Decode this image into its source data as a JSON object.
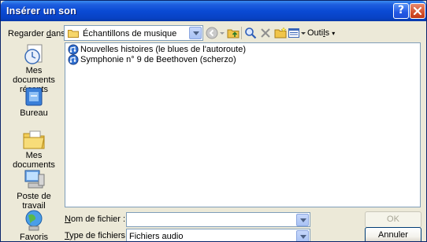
{
  "window": {
    "title": "Insérer un son",
    "help_button": "?"
  },
  "lookin": {
    "label_pre": "Regarder ",
    "label_mnemonic": "d",
    "label_post": "ans :",
    "value": "Échantillons de musique"
  },
  "toolbar": {
    "tools_pre": "Outi",
    "tools_mnemonic": "l",
    "tools_post": "s"
  },
  "places": [
    {
      "label": "Mes documents récents",
      "icon": "recent-documents-icon"
    },
    {
      "label": "Bureau",
      "icon": "desktop-icon"
    },
    {
      "label": "Mes documents",
      "icon": "my-documents-icon"
    },
    {
      "label": "Poste de travail",
      "icon": "my-computer-icon"
    },
    {
      "label": "Favoris réseau",
      "icon": "network-places-icon"
    }
  ],
  "files": [
    {
      "name": "Nouvelles histoires (le blues de l'autoroute)",
      "icon": "audio-file-icon"
    },
    {
      "name": "Symphonie n° 9 de Beethoven (scherzo)",
      "icon": "audio-file-icon"
    }
  ],
  "filename": {
    "label_mnemonic": "N",
    "label_post": "om de fichier :",
    "value": ""
  },
  "filetype": {
    "label_mnemonic": "T",
    "label_post": "ype de fichiers :",
    "value": "Fichiers audio"
  },
  "buttons": {
    "ok": "OK",
    "cancel": "Annuler"
  },
  "colors": {
    "titlebar": "#0a4ad4",
    "dialog_bg": "#ece9d8",
    "close_button": "#d5522f"
  }
}
